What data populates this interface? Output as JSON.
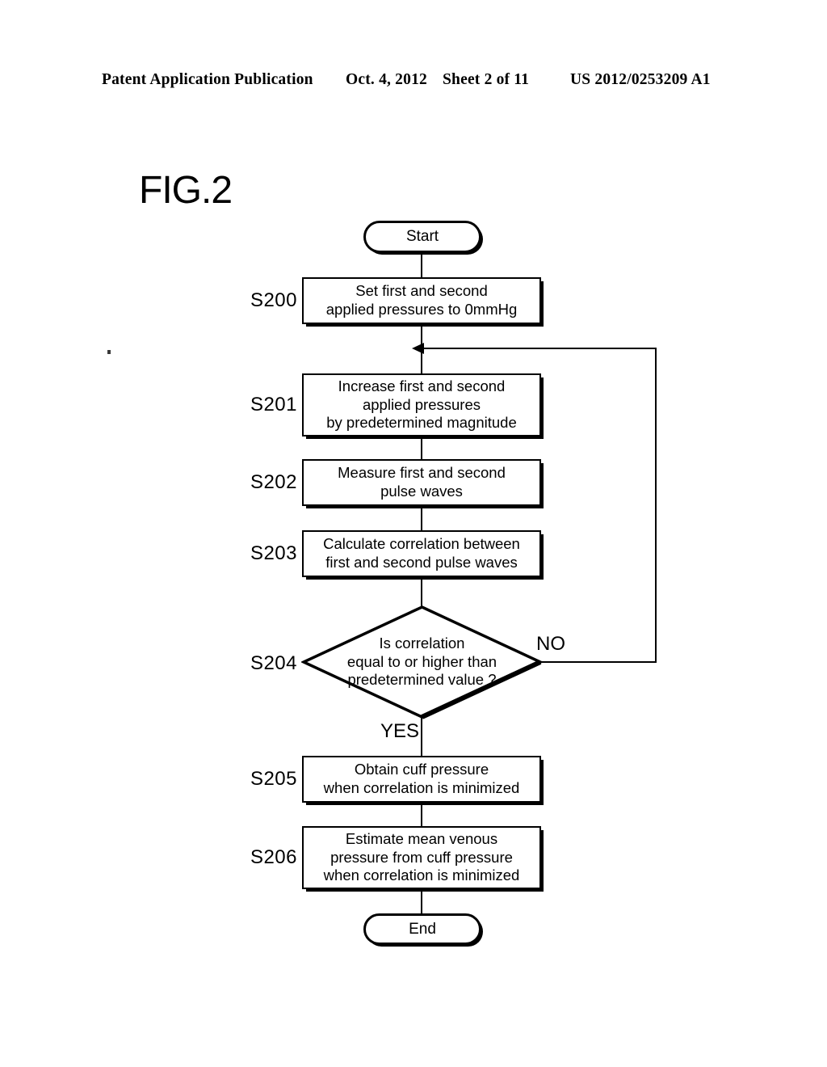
{
  "header": {
    "publication": "Patent Application Publication",
    "date": "Oct. 4, 2012",
    "sheet": "Sheet 2 of 11",
    "patent_number": "US 2012/0253209 A1"
  },
  "figure": {
    "title": "FIG.2"
  },
  "flowchart": {
    "start_label": "Start",
    "end_label": "End",
    "branch_yes": "YES",
    "branch_no": "NO",
    "steps": [
      {
        "id": "S200",
        "text": "Set first and second\napplied pressures to 0mmHg"
      },
      {
        "id": "S201",
        "text": "Increase first and second\napplied pressures\nby predetermined magnitude"
      },
      {
        "id": "S202",
        "text": "Measure first and second\npulse waves"
      },
      {
        "id": "S203",
        "text": "Calculate correlation between\nfirst and second pulse waves"
      },
      {
        "id": "S204",
        "text": "Is correlation\nequal to or higher than\npredetermined value ?"
      },
      {
        "id": "S205",
        "text": "Obtain cuff pressure\nwhen correlation is minimized"
      },
      {
        "id": "S206",
        "text": "Estimate mean venous\npressure from cuff pressure\nwhen correlation is minimized"
      }
    ]
  },
  "colors": {
    "ink": "#000000",
    "paper": "#ffffff"
  }
}
